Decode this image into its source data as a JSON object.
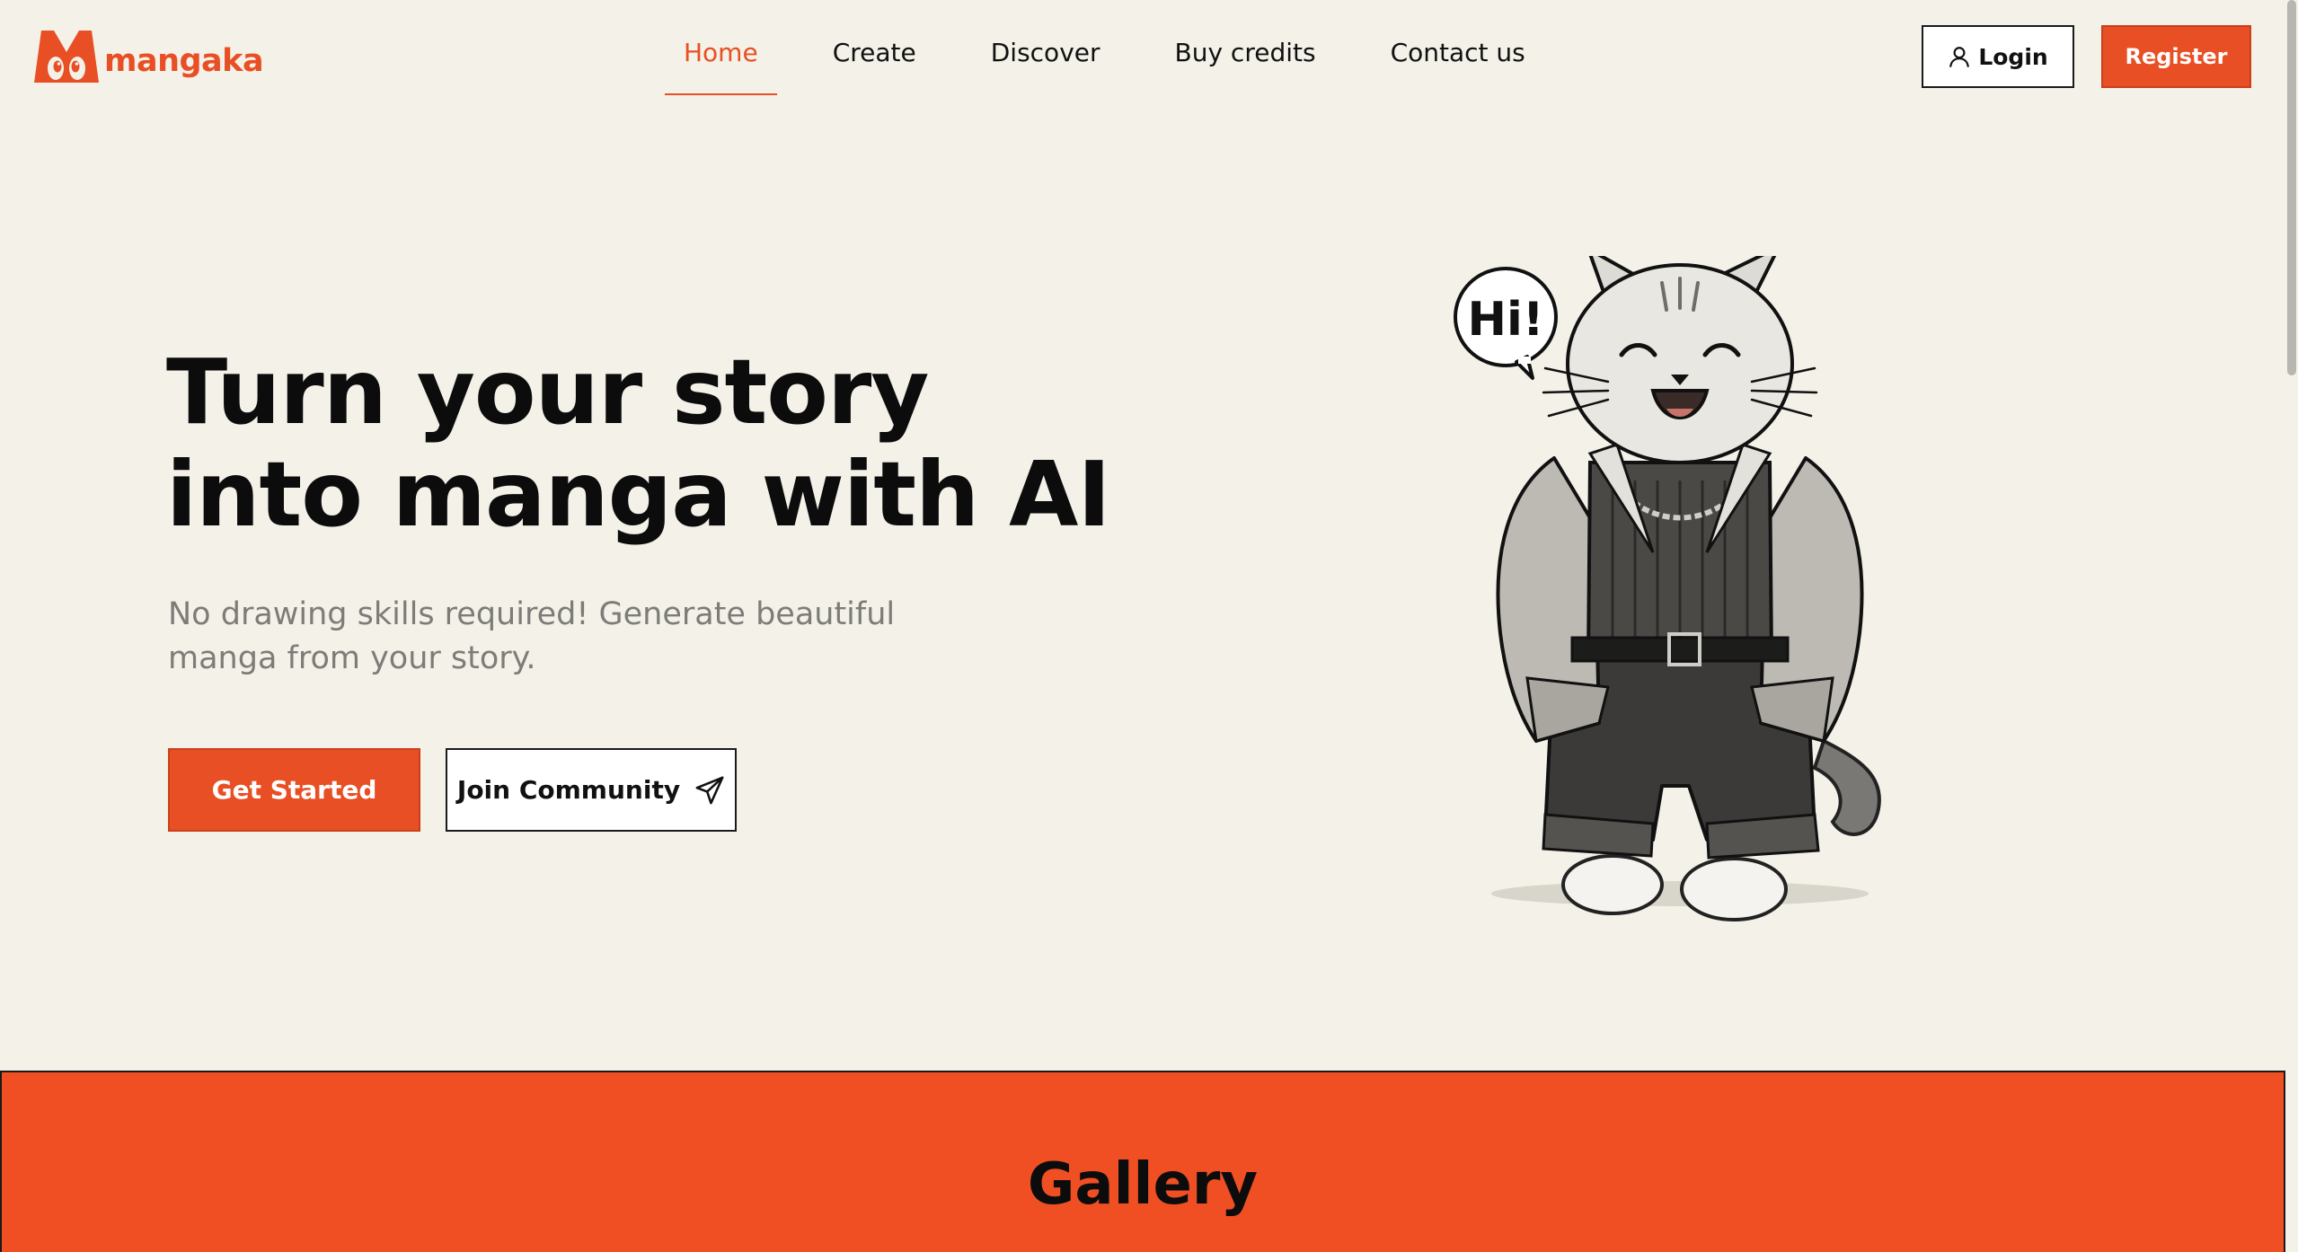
{
  "brand": {
    "name": "mangaka",
    "accent_color": "#e84f25",
    "logo_icon": "m-mascot-logo-icon"
  },
  "nav": {
    "items": [
      {
        "label": "Home",
        "active": true
      },
      {
        "label": "Create",
        "active": false
      },
      {
        "label": "Discover",
        "active": false
      },
      {
        "label": "Buy credits",
        "active": false
      },
      {
        "label": "Contact us",
        "active": false
      }
    ]
  },
  "auth": {
    "login_label": "Login",
    "login_icon": "user-icon",
    "register_label": "Register"
  },
  "hero": {
    "title_line1": "Turn your story",
    "title_line2": "into manga with AI",
    "subtitle_line1": "No drawing skills required! Generate beautiful",
    "subtitle_line2": "manga from your story.",
    "primary_cta": "Get Started",
    "secondary_cta": "Join Community",
    "secondary_cta_icon": "paper-plane-icon",
    "illustration": {
      "speech_bubble": "Hi!",
      "subject_icon": "cat-mascot-illustration"
    }
  },
  "gallery": {
    "title": "Gallery",
    "background": "#ef4f23"
  }
}
